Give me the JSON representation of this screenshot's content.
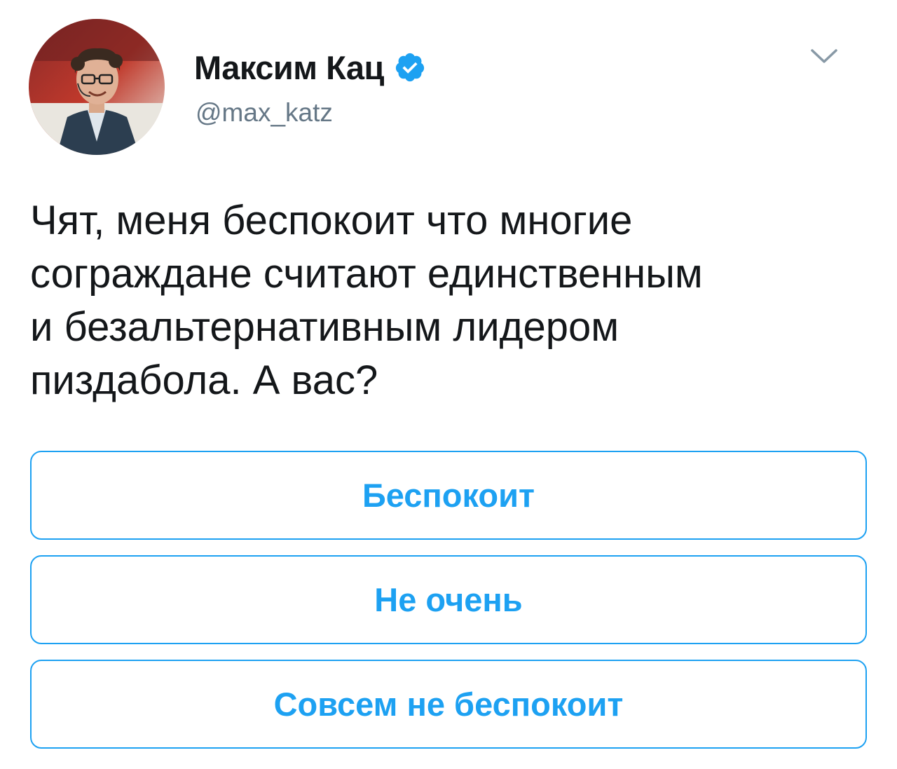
{
  "tweet": {
    "author": {
      "display_name": "Максим Кац",
      "handle": "@max_katz",
      "verified": true,
      "avatar_icon": "profile-photo",
      "verified_icon": "verified-badge-icon"
    },
    "more_icon": "chevron-down-icon",
    "text_lines": [
      "Чят, меня беспокоит что многие",
      "сограждане считают единственным",
      "и безальтернативным лидером",
      "пиздабола. А вас?"
    ]
  },
  "poll": {
    "options": [
      {
        "label": "Беспокоит"
      },
      {
        "label": "Не очень"
      },
      {
        "label": "Совсем не беспокоит"
      }
    ]
  },
  "colors": {
    "accent": "#1da1f2",
    "text": "#14171a",
    "secondary_text": "#657786",
    "background": "#ffffff"
  }
}
